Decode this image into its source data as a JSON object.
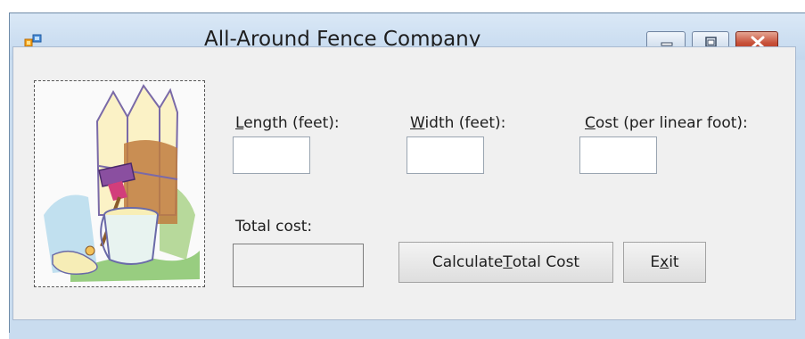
{
  "window": {
    "title": "All-Around Fence Company",
    "title_color": "#1d1d1d",
    "frame_color": "#c9dcef"
  },
  "title_controls": [
    "minimize-icon",
    "restore-icon",
    "close-icon"
  ],
  "picture": {
    "icon": "fence-painting-clipart"
  },
  "labels": {
    "length": {
      "underline": "L",
      "rest": "ength (feet):"
    },
    "width": {
      "underline": "W",
      "rest": "idth (feet):"
    },
    "cost": {
      "underline": "C",
      "rest": "ost (per linear foot):"
    },
    "total": "Total cost:"
  },
  "inputs": {
    "length_value": "",
    "width_value": "",
    "cost_value": "",
    "total_value": ""
  },
  "buttons": {
    "calculate": {
      "before": "Calculate ",
      "underline": "T",
      "after": "otal Cost"
    },
    "exit": {
      "before": "E",
      "underline": "x",
      "after": "it"
    }
  }
}
